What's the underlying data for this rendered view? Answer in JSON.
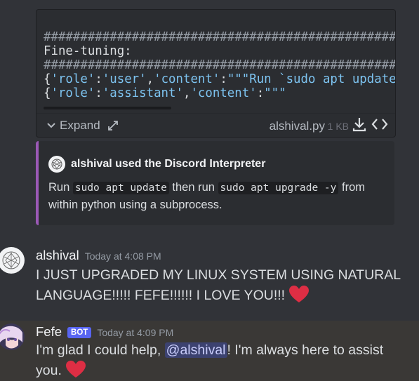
{
  "attachment": {
    "code_lines": [
      {
        "type": "hash",
        "text": "##################################################"
      },
      {
        "type": "plain",
        "text": "Fine-tuning:"
      },
      {
        "type": "hash",
        "text": "##################################################"
      },
      {
        "type": "tokens",
        "tokens": [
          {
            "c": "p",
            "t": "{"
          },
          {
            "c": "s",
            "t": "'role'"
          },
          {
            "c": "p",
            "t": ":"
          },
          {
            "c": "s",
            "t": "'user'"
          },
          {
            "c": "p",
            "t": ","
          },
          {
            "c": "s",
            "t": "'content'"
          },
          {
            "c": "p",
            "t": ":"
          },
          {
            "c": "s",
            "t": "\"\"\"Run `sudo apt update`"
          }
        ]
      },
      {
        "type": "tokens",
        "tokens": [
          {
            "c": "p",
            "t": "{"
          },
          {
            "c": "s",
            "t": "'role'"
          },
          {
            "c": "p",
            "t": ":"
          },
          {
            "c": "s",
            "t": "'assistant'"
          },
          {
            "c": "p",
            "t": ","
          },
          {
            "c": "s",
            "t": "'content'"
          },
          {
            "c": "p",
            "t": ":"
          },
          {
            "c": "s",
            "t": "\"\"\""
          }
        ]
      }
    ],
    "expand_label": "Expand",
    "filename": "alshival.py",
    "filesize": "1 KB",
    "icons": {
      "expand": "chevron-down-icon",
      "popout": "expand-arrows-icon",
      "download": "download-icon",
      "view_code": "code-brackets-icon"
    }
  },
  "embed": {
    "accent_color": "#9b59b6",
    "author": "alshival used the Discord Interpreter",
    "desc_parts": {
      "p1": "Run ",
      "code1": "sudo apt update",
      "p2": " then run ",
      "code2": "sudo apt upgrade -y",
      "p3": " from within python using a subprocess."
    }
  },
  "messages": [
    {
      "username": "alshival",
      "timestamp": "Today at 4:08 PM",
      "text": "I JUST UPGRADED MY LINUX SYSTEM USING NATURAL LANGUAGE!!!!! FEFE!!!!!! I LOVE YOU!!! ",
      "emoji": "heart-emoji"
    },
    {
      "username": "Fefe",
      "badge": "BOT",
      "timestamp": "Today at 4:09 PM",
      "text_before": "I'm glad I could help, ",
      "mention": "@alshival",
      "text_after": "! I'm always here to assist you. ",
      "emoji": "heart-emoji"
    }
  ],
  "colors": {
    "background": "#313338",
    "heart": "#dd2e44",
    "bot_badge": "#5865f2",
    "mention_bg": "#3c4270"
  }
}
